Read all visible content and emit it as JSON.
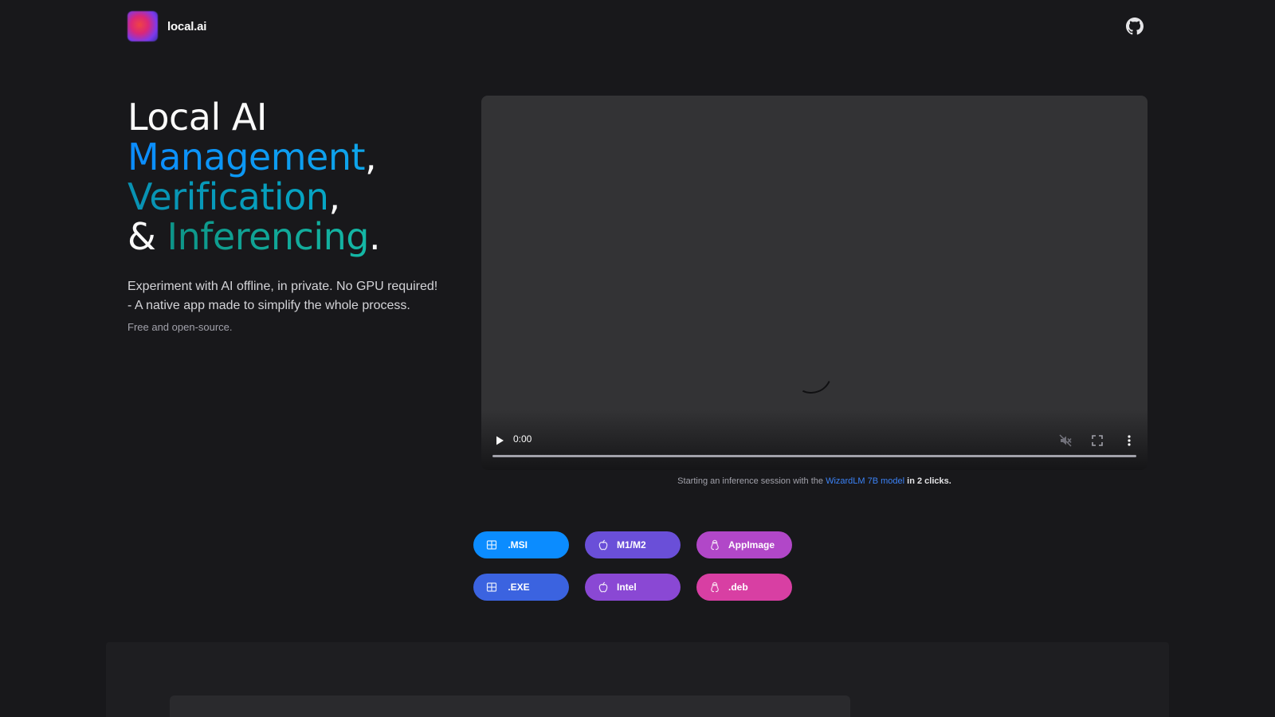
{
  "header": {
    "logo_text": "local.ai",
    "github_icon": "github-icon"
  },
  "hero": {
    "line1": "Local AI",
    "line2_highlight": "Management",
    "line2_suffix": ",",
    "line3_highlight": "Verification",
    "line3_suffix": ",",
    "line4_prefix": "& ",
    "line4_highlight": "Inferencing",
    "line4_suffix": ".",
    "description_line1": "Experiment with AI offline, in private. No GPU required!",
    "description_line2": "- A native app made to simplify the whole process.",
    "note": "Free and open-source."
  },
  "video": {
    "time": "0:00",
    "caption_prefix": "Starting an inference session with the ",
    "caption_link": "WizardLM 7B model",
    "caption_bold": " in 2 clicks."
  },
  "downloads": {
    "msi": " .MSI",
    "exe": " .EXE",
    "m1": "M1/M2",
    "intel": "Intel",
    "appimage": "AppImage",
    "deb": ".deb"
  },
  "colors": {
    "background": "#18181b",
    "accent_blue": "#0b8cff",
    "accent_teal": "#14b8a6"
  }
}
